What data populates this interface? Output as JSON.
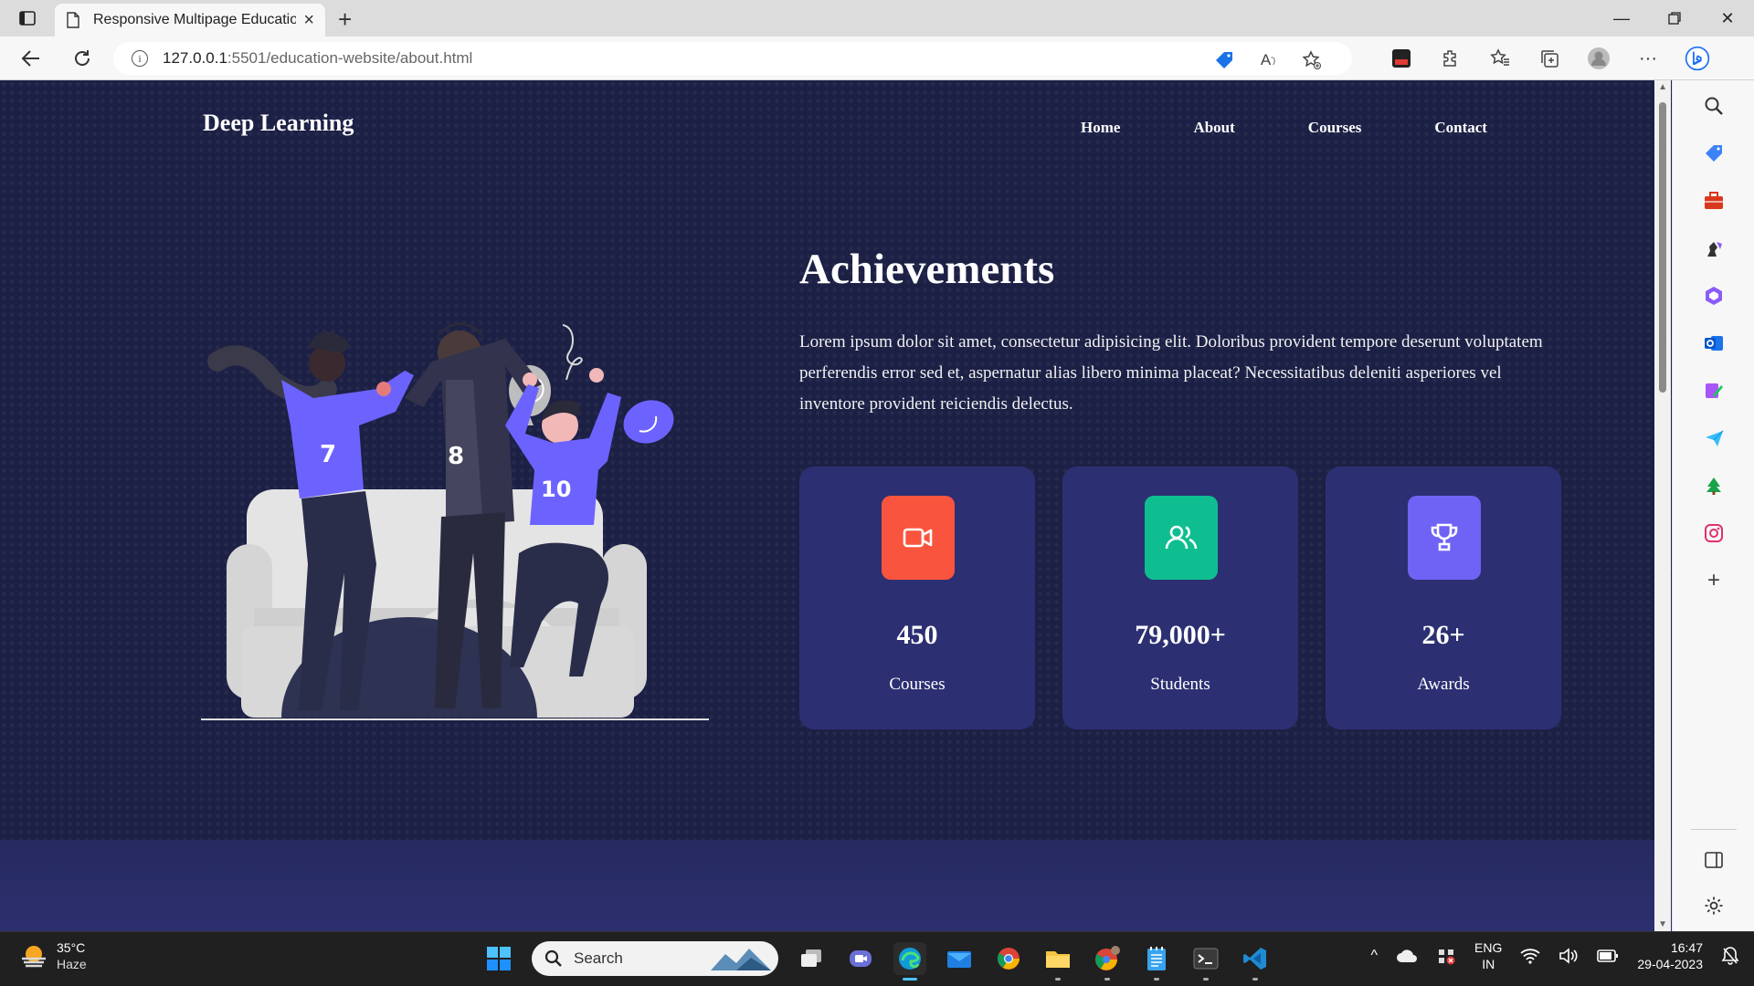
{
  "browser": {
    "tab_title": "Responsive Multipage Education",
    "url_host": "127.0.0.1",
    "url_rest": ":5501/education-website/about.html"
  },
  "site": {
    "brand": "Deep Learning",
    "nav": [
      "Home",
      "About",
      "Courses",
      "Contact"
    ]
  },
  "illustration": {
    "jersey_numbers": [
      "7",
      "8",
      "10"
    ]
  },
  "achievements": {
    "title": "Achievements",
    "description": "Lorem ipsum dolor sit amet, consectetur adipisicing elit. Doloribus provident tempore deserunt voluptatem perferendis error sed et, aspernatur alias libero minima placeat? Necessitatibus deleniti asperiores vel inventore provident reiciendis delectus.",
    "stats": [
      {
        "value": "450",
        "label": "Courses",
        "icon": "video-camera-icon",
        "color": "#f9553e"
      },
      {
        "value": "79,000+",
        "label": "Students",
        "icon": "users-icon",
        "color": "#0fbe90"
      },
      {
        "value": "26+",
        "label": "Awards",
        "icon": "trophy-icon",
        "color": "#6f63f5"
      }
    ]
  },
  "taskbar": {
    "weather_temp": "35°C",
    "weather_desc": "Haze",
    "search_label": "Search",
    "lang_top": "ENG",
    "lang_bottom": "IN",
    "time": "16:47",
    "date": "29-04-2023"
  },
  "colors": {
    "page_bg": "#1c2045",
    "card_bg": "#2c3072",
    "accent_purple": "#6c63ff"
  }
}
